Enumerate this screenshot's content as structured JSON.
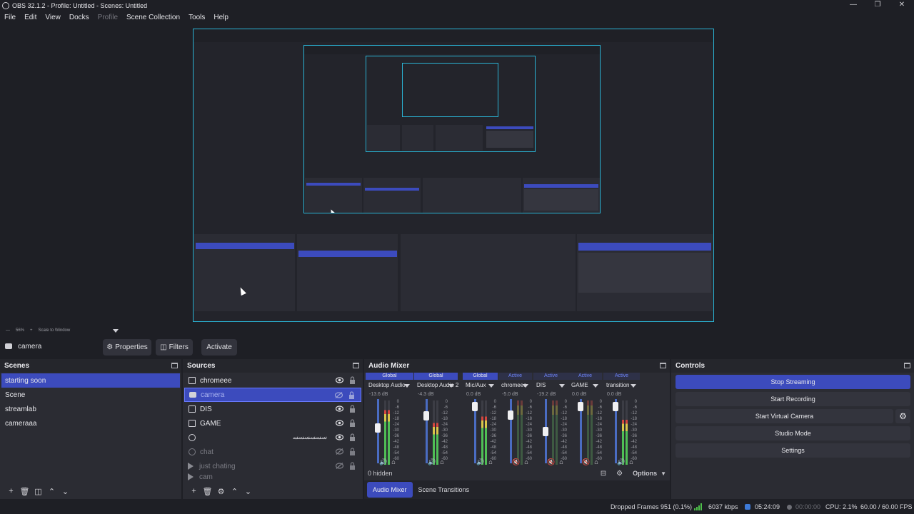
{
  "window": {
    "title": "OBS 32.1.2 - Profile: Untitled - Scenes: Untitled"
  },
  "menu": [
    "File",
    "Edit",
    "View",
    "Docks",
    "Profile",
    "Scene Collection",
    "Tools",
    "Help"
  ],
  "zoom": {
    "level": "56%",
    "mode": "Scale to Window"
  },
  "source_toolbar": {
    "selected_source": "camera",
    "properties": "Properties",
    "filters": "Filters",
    "activate": "Activate"
  },
  "scenes": {
    "title": "Scenes",
    "items": [
      "starting soon",
      "Scene",
      "streamlab",
      "cameraaa"
    ]
  },
  "sources": {
    "title": "Sources",
    "items": [
      {
        "name": "chromeee",
        "icon": "screen-icon"
      },
      {
        "name": "camera",
        "icon": "camera-icon"
      },
      {
        "name": "DIS",
        "icon": "screen-icon"
      },
      {
        "name": "GAME",
        "icon": "screen-icon"
      },
      {
        "name": "",
        "icon": "browser-icon",
        "rtl": "ﺳﺴﺴﺴﺴﺴ"
      },
      {
        "name": "chat",
        "icon": "browser-icon"
      },
      {
        "name": "just chating",
        "icon": "media-icon"
      },
      {
        "name": "cam",
        "icon": "media-icon"
      }
    ]
  },
  "mixer": {
    "title": "Audio Mixer",
    "channels": [
      {
        "tag": "Global",
        "name": "Desktop Audio",
        "db": "-13.6 dB",
        "level": 0.85
      },
      {
        "tag": "Global",
        "name": "Desktop Audio 2",
        "db": "-4.3 dB",
        "level": 0.65
      },
      {
        "tag": "Global",
        "name": "Mic/Aux",
        "db": "0.0 dB",
        "level": 0.75
      },
      {
        "tag": "Active",
        "name": "chromeee",
        "db": "-5.0 dB",
        "level": 0.0
      },
      {
        "tag": "Active",
        "name": "DIS",
        "db": "-19.2 dB",
        "level": 0.0
      },
      {
        "tag": "Active",
        "name": "GAME",
        "db": "0.0 dB",
        "level": 0.0
      },
      {
        "tag": "Active",
        "name": "transition",
        "db": "0.0 dB",
        "level": 0.7
      }
    ],
    "scale": [
      "0",
      "-6",
      "-12",
      "-18",
      "-24",
      "-30",
      "-36",
      "-42",
      "-48",
      "-54",
      "-60"
    ],
    "hidden": "0 hidden",
    "options": "Options"
  },
  "dock_tabs": {
    "mixer": "Audio Mixer",
    "transitions": "Scene Transitions"
  },
  "controls": {
    "title": "Controls",
    "stop_streaming": "Stop Streaming",
    "start_recording": "Start Recording",
    "start_virtual_camera": "Start Virtual Camera",
    "studio_mode": "Studio Mode",
    "settings": "Settings"
  },
  "status": {
    "dropped_frames": "Dropped Frames 951 (0.1%)",
    "bitrate": "6037 kbps",
    "stream_time": "05:24:09",
    "rec_time": "00:00:00",
    "cpu": "CPU: 2.1%",
    "fps": "60.00 / 60.00 FPS"
  },
  "colors": {
    "accent": "#3c4bbd",
    "preview_border": "#2ab3d4",
    "live_green": "#4ec24a"
  }
}
